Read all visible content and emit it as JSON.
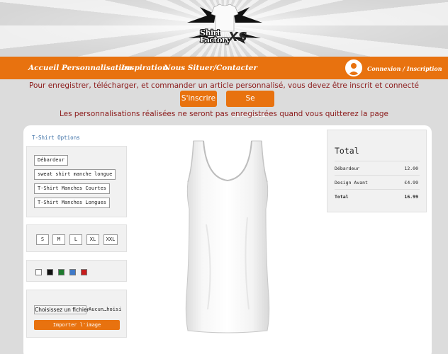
{
  "header": {
    "logo_text": "Shirt Factory",
    "logo_xs": "XS"
  },
  "nav": {
    "items": [
      "Accueil",
      "Personnalisation",
      "Inspiration",
      "Nous Situer/Contacter"
    ],
    "login": "Connexion / Inscription"
  },
  "notice": {
    "line1": "Pour enregistrer, télécharger, et commander un article personnalisé, vous devez être inscrit et connecté",
    "signup": "S'inscrire",
    "login": "Se connecter",
    "line2": "Les personnalisations réalisées ne seront pas enregistrées quand vous quitterez la page"
  },
  "options": {
    "title": "T-Shirt Options",
    "types": [
      "Débardeur",
      "sweat shirt manche longue",
      "T-Shirt Manches Courtes",
      "T-Shirt Manches Longues"
    ],
    "sizes": [
      "S",
      "M",
      "L",
      "XL",
      "XXL"
    ],
    "colors": [
      "#ffffff",
      "#111111",
      "#1f7a2e",
      "#3f7ac9",
      "#c91d1d"
    ],
    "file_button": "Choisissez un fichier",
    "file_name": "Aucun…hoisi",
    "import_button": "Importer l'image"
  },
  "total": {
    "title": "Total",
    "rows": [
      {
        "label": "Débardeur",
        "value": "12.00"
      },
      {
        "label": "Design Avant",
        "value": "€4.99"
      },
      {
        "label": "Total",
        "value": "16.99"
      }
    ]
  },
  "colors": {
    "accent": "#e8720f",
    "notice": "#8b1a1a",
    "link": "#3a6ea5"
  }
}
